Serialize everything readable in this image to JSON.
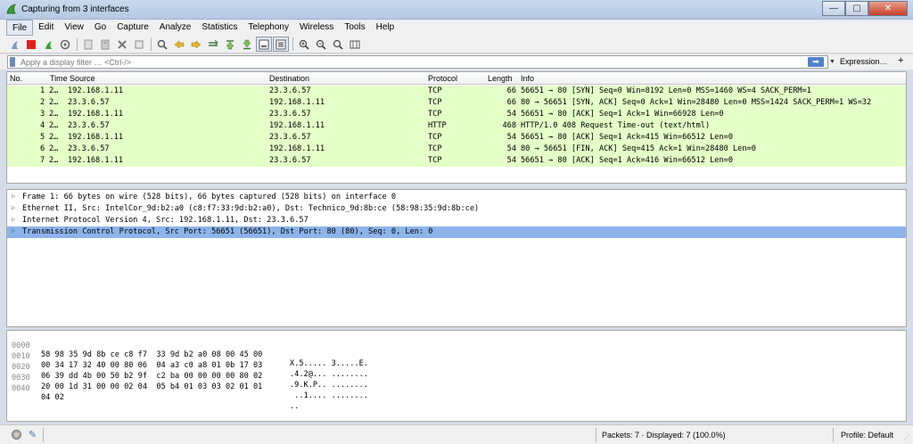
{
  "window": {
    "title": "Capturing from 3 interfaces",
    "min": "—",
    "max": "▢",
    "close": "✕"
  },
  "menu": [
    "File",
    "Edit",
    "View",
    "Go",
    "Capture",
    "Analyze",
    "Statistics",
    "Telephony",
    "Wireless",
    "Tools",
    "Help"
  ],
  "filter": {
    "placeholder": "Apply a display filter … <Ctrl-/>",
    "expression": "Expression…",
    "plus": "+"
  },
  "packet_list": {
    "columns": [
      "No.",
      "Time",
      "Source",
      "Destination",
      "Protocol",
      "Length",
      "Info"
    ],
    "rows": [
      {
        "no": "1",
        "time": "2…",
        "src": "192.168.1.11",
        "dst": "23.3.6.57",
        "proto": "TCP",
        "len": "66",
        "info": "56651 → 80 [SYN] Seq=0 Win=8192 Len=0 MSS=1460 WS=4 SACK_PERM=1"
      },
      {
        "no": "2",
        "time": "2…",
        "src": "23.3.6.57",
        "dst": "192.168.1.11",
        "proto": "TCP",
        "len": "66",
        "info": "80 → 56651 [SYN, ACK] Seq=0 Ack=1 Win=28480 Len=0 MSS=1424 SACK_PERM=1 WS=32"
      },
      {
        "no": "3",
        "time": "2…",
        "src": "192.168.1.11",
        "dst": "23.3.6.57",
        "proto": "TCP",
        "len": "54",
        "info": "56651 → 80 [ACK] Seq=1 Ack=1 Win=66928 Len=0"
      },
      {
        "no": "4",
        "time": "2…",
        "src": "23.3.6.57",
        "dst": "192.168.1.11",
        "proto": "HTTP",
        "len": "468",
        "info": "HTTP/1.0 408 Request Time-out  (text/html)"
      },
      {
        "no": "5",
        "time": "2…",
        "src": "192.168.1.11",
        "dst": "23.3.6.57",
        "proto": "TCP",
        "len": "54",
        "info": "56651 → 80 [ACK] Seq=1 Ack=415 Win=66512 Len=0"
      },
      {
        "no": "6",
        "time": "2…",
        "src": "23.3.6.57",
        "dst": "192.168.1.11",
        "proto": "TCP",
        "len": "54",
        "info": "80 → 56651 [FIN, ACK] Seq=415 Ack=1 Win=28480 Len=0"
      },
      {
        "no": "7",
        "time": "2…",
        "src": "192.168.1.11",
        "dst": "23.3.6.57",
        "proto": "TCP",
        "len": "54",
        "info": "56651 → 80 [ACK] Seq=1 Ack=416 Win=66512 Len=0"
      }
    ]
  },
  "details": [
    "Frame 1: 66 bytes on wire (528 bits), 66 bytes captured (528 bits) on interface 0",
    "Ethernet II, Src: IntelCor_9d:b2:a0 (c8:f7:33:9d:b2:a0), Dst: Technico_9d:8b:ce (58:98:35:9d:8b:ce)",
    "Internet Protocol Version 4, Src: 192.168.1.11, Dst: 23.3.6.57",
    "Transmission Control Protocol, Src Port: 56651 (56651), Dst Port: 80 (80), Seq: 0, Len: 0"
  ],
  "bytes": [
    {
      "off": "0000",
      "hex": "58 98 35 9d 8b ce c8 f7  33 9d b2 a0 08 00 45 00",
      "ascii": "X.5..... 3.....E."
    },
    {
      "off": "0010",
      "hex": "00 34 17 32 40 00 80 06  04 a3 c0 a8 01 0b 17 03",
      "ascii": ".4.2@... ........"
    },
    {
      "off": "0020",
      "hex": "06 39 dd 4b 00 50 b2 9f  c2 ba 00 00 00 00 80 02",
      "ascii": ".9.K.P.. ........"
    },
    {
      "off": "0030",
      "hex": "20 00 1d 31 00 00 02 04  05 b4 01 03 03 02 01 01",
      "ascii": " ..1.... ........"
    },
    {
      "off": "0040",
      "hex": "04 02",
      "ascii": ".."
    }
  ],
  "status": {
    "packets": "Packets: 7 · Displayed: 7 (100.0%)",
    "profile": "Profile: Default"
  },
  "colors": {
    "tcp_row": "#e4ffc7",
    "selected_detail": "#8cb4ea"
  }
}
